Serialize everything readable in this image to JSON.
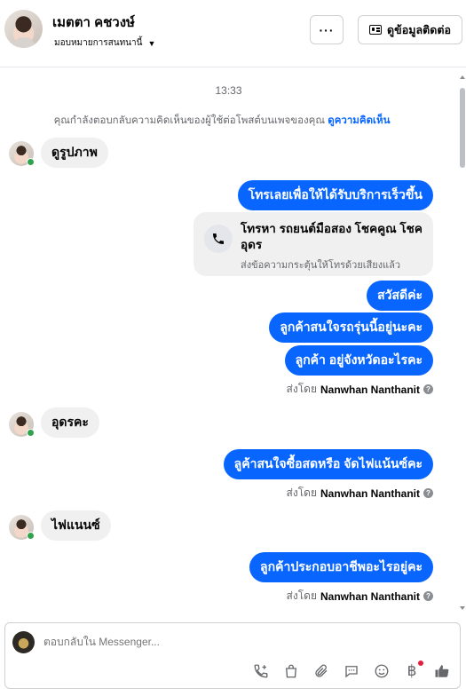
{
  "header": {
    "name": "เมตตา คชวงษ์",
    "subtitle": "มอบหมายการสนทนานี้",
    "more_label": "···",
    "contact_button": "ดูข้อมูลติดต่อ"
  },
  "conversation": {
    "time": "13:33",
    "notice_text": "คุณกำลังตอบกลับความคิดเห็นของผู้ใช้ต่อโพสต์บนเพจของคุณ",
    "notice_link": "ดูความคิดเห็น",
    "messages": [
      {
        "dir": "in",
        "text": "ดูรูปภาพ"
      },
      {
        "dir": "out",
        "text": "โทรเลยเพื่อให้ได้รับบริการเร็วขึ้น"
      },
      {
        "dir": "out",
        "text": "สวัสดีค่ะ"
      },
      {
        "dir": "out",
        "text": "ลูกค้าสนใจรถรุ่นนี้อยู่นะคะ"
      },
      {
        "dir": "out",
        "text": "ลูกค้า อยู่จังหวัดอะไรคะ"
      },
      {
        "dir": "in",
        "text": "อุดรคะ"
      },
      {
        "dir": "out",
        "text": "ลูค้าสนใจซื้อสดหรือ จัดไฟแน้นซ์คะ"
      },
      {
        "dir": "in",
        "text": "ไฟแนนซ์"
      },
      {
        "dir": "out",
        "text": "ลูกค้าประกอบอาชีพอะไรอยู่คะ"
      }
    ],
    "call_card": {
      "title": "โทรหา รถยนต์มือสอง โชคคูณ โชค อุดร",
      "subtitle": "ส่งข้อความกระตุ้นให้โทรด้วยเสียงแล้ว"
    },
    "sent_by_prefix": "ส่งโดย",
    "sent_by_name": "Nanwhan Nanthanit"
  },
  "composer": {
    "placeholder": "ตอบกลับใน Messenger..."
  },
  "icons": [
    "phone-plus-icon",
    "shopping-bag-icon",
    "paperclip-icon",
    "chat-icon",
    "emoji-icon",
    "baht-icon",
    "like-icon"
  ],
  "colors": {
    "accent": "#0866ff",
    "bubble_in": "#f0f0f0",
    "online": "#31a24c"
  }
}
